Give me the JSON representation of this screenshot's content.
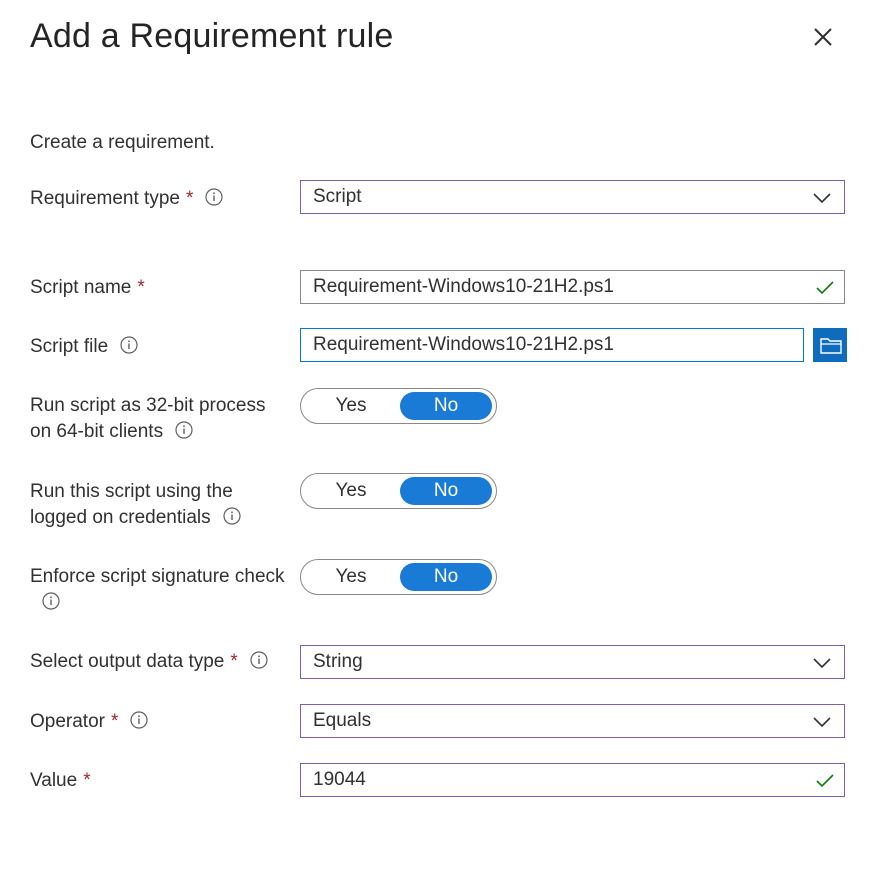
{
  "panel": {
    "title": "Add a Requirement rule",
    "intro": "Create a requirement."
  },
  "fields": {
    "requirement_type": {
      "label": "Requirement type",
      "required": "*",
      "value": "Script"
    },
    "script_name": {
      "label": "Script name",
      "required": "*",
      "value": "Requirement-Windows10-21H2.ps1"
    },
    "script_file": {
      "label": "Script file",
      "value": "Requirement-Windows10-21H2.ps1"
    },
    "run_32bit": {
      "label_line1": "Run script as 32-bit process",
      "label_line2": "on 64-bit clients",
      "yes": "Yes",
      "no": "No",
      "selected": "No"
    },
    "run_logged_on": {
      "label_line1": "Run this script using the",
      "label_line2": "logged on credentials",
      "yes": "Yes",
      "no": "No",
      "selected": "No"
    },
    "enforce_signature": {
      "label_line1": "Enforce script signature check",
      "yes": "Yes",
      "no": "No",
      "selected": "No"
    },
    "output_type": {
      "label": "Select output data type",
      "required": "*",
      "value": "String"
    },
    "operator": {
      "label": "Operator",
      "required": "*",
      "value": "Equals"
    },
    "value": {
      "label": "Value",
      "required": "*",
      "value": "19044"
    }
  },
  "colors": {
    "accent": "#1a7bd6",
    "required": "#a4262c",
    "valid_check": "#107c10",
    "field_focus_border": "#7b5cb0"
  },
  "icons": {
    "close": "close-icon",
    "info": "info-icon",
    "dropdown": "chevron-down-icon",
    "valid": "checkmark-icon",
    "browse": "folder-icon"
  }
}
